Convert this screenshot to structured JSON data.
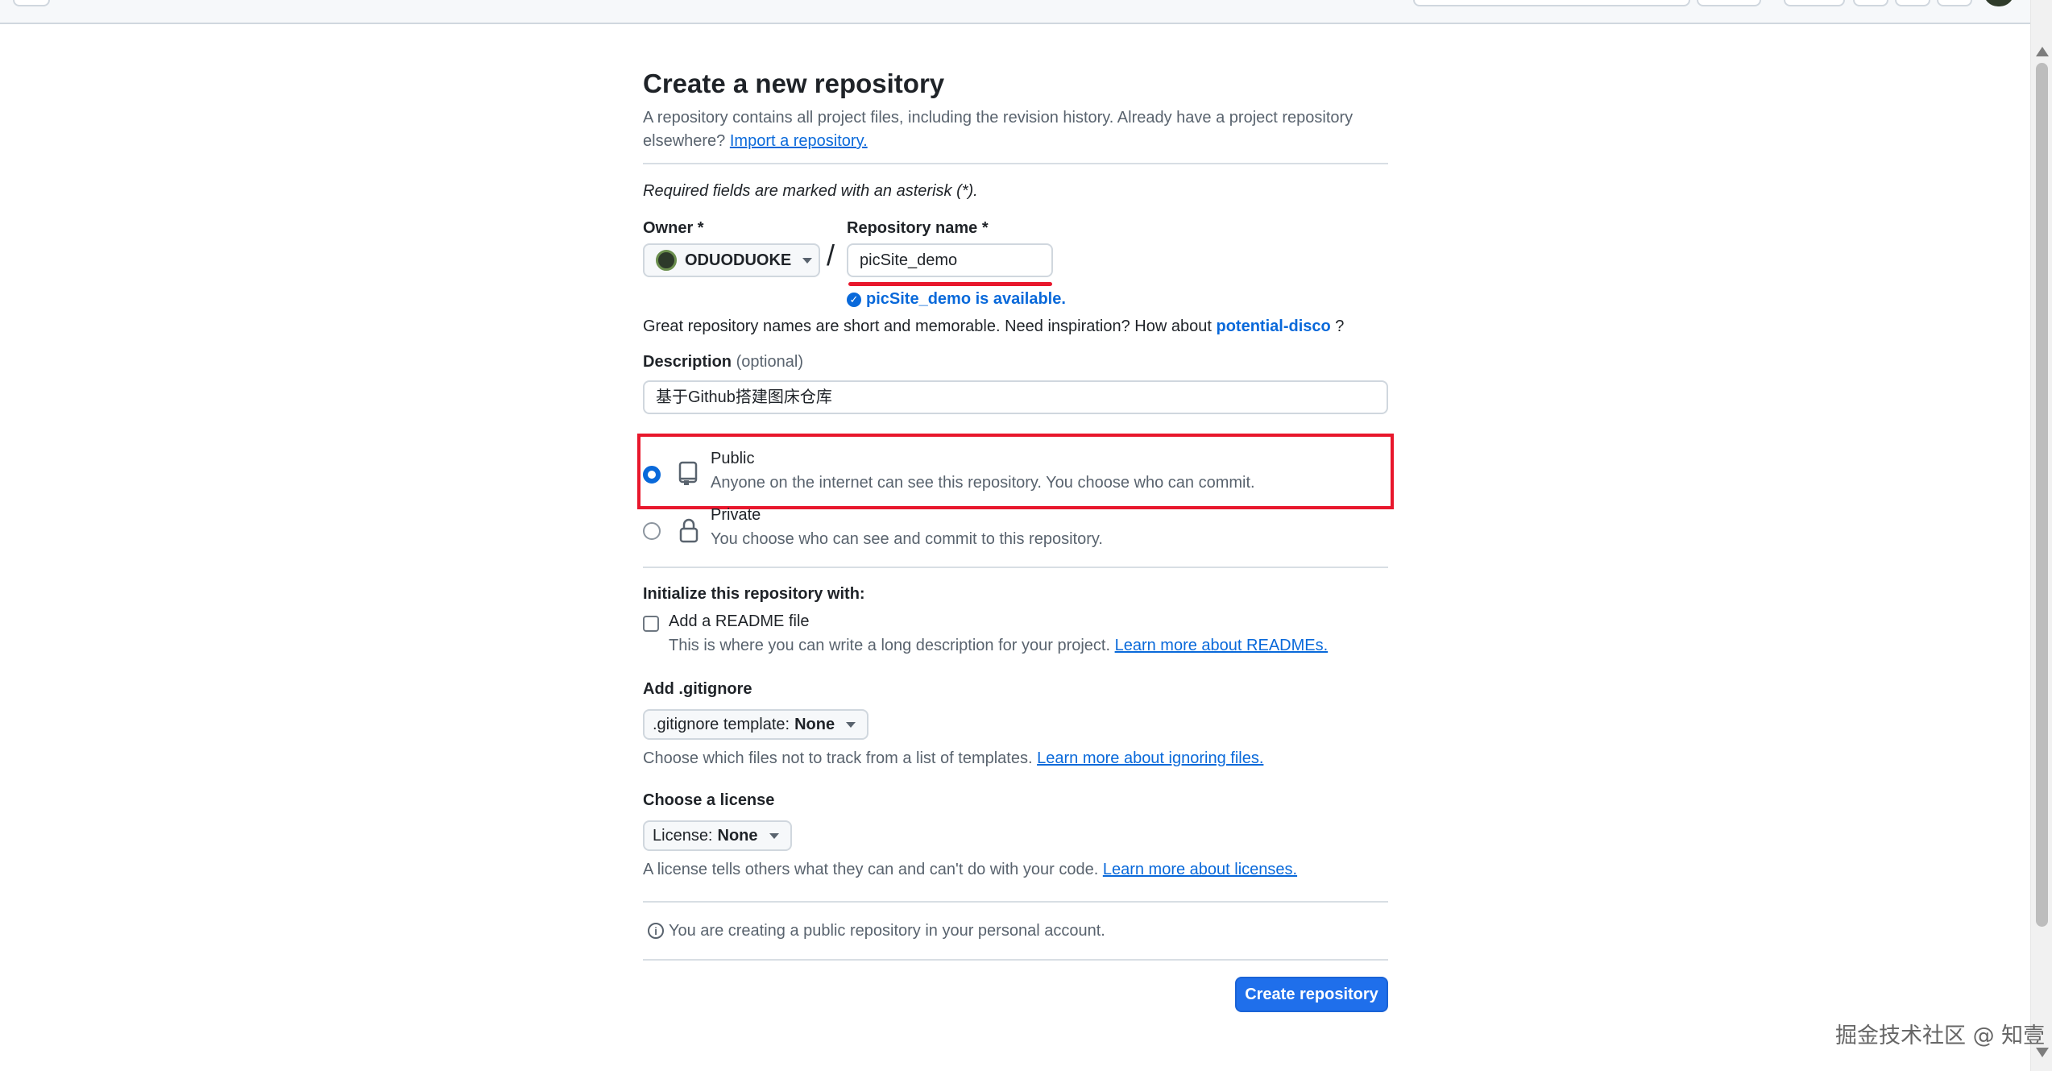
{
  "page": {
    "title": "Create a new repository",
    "intro_text": "A repository contains all project files, including the revision history. Already have a project repository elsewhere?",
    "import_link": "Import a repository.",
    "required_note": "Required fields are marked with an asterisk (*)."
  },
  "owner": {
    "label": "Owner *",
    "value": "ODUODUOKE"
  },
  "repo_name": {
    "label": "Repository name *",
    "value": "picSite_demo",
    "availability": "picSite_demo is available."
  },
  "suggestion": {
    "text": "Great repository names are short and memorable. Need inspiration? How about",
    "name": "potential-disco",
    "suffix": "?"
  },
  "description": {
    "label": "Description",
    "optional": "(optional)",
    "value": "基于Github搭建图床仓库"
  },
  "visibility": {
    "public_title": "Public",
    "public_desc": "Anyone on the internet can see this repository. You choose who can commit.",
    "private_title": "Private",
    "private_desc": "You choose who can see and commit to this repository.",
    "selected": "public"
  },
  "initialize": {
    "label": "Initialize this repository with:",
    "readme_label": "Add a README file",
    "readme_desc": "This is where you can write a long description for your project.",
    "readme_link": "Learn more about READMEs."
  },
  "gitignore": {
    "label": "Add .gitignore",
    "dropdown_prefix": ".gitignore template:",
    "dropdown_value": "None",
    "hint": "Choose which files not to track from a list of templates.",
    "hint_link": "Learn more about ignoring files."
  },
  "license": {
    "label": "Choose a license",
    "dropdown_prefix": "License:",
    "dropdown_value": "None",
    "hint": "A license tells others what they can and can't do with your code.",
    "hint_link": "Learn more about licenses."
  },
  "info": {
    "text": "You are creating a public repository in your personal account."
  },
  "actions": {
    "create_label": "Create repository"
  },
  "watermark": "掘金技术社区 @ 知壹",
  "colors": {
    "accent": "#0969da",
    "primary_button": "#1f6feb",
    "annotation_red": "#e8172c"
  }
}
